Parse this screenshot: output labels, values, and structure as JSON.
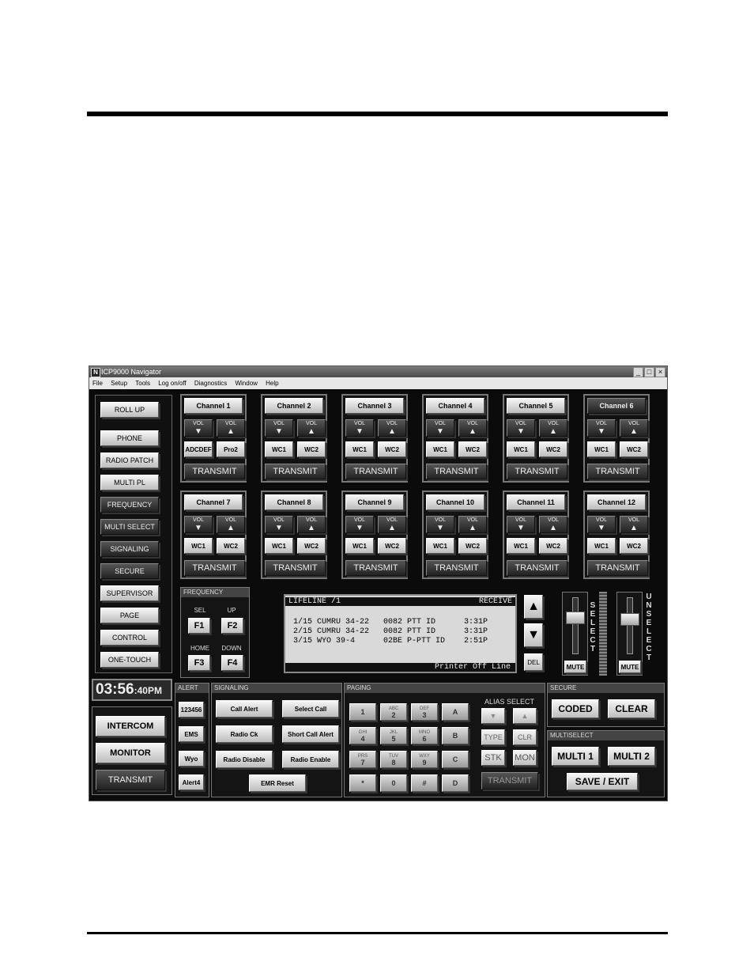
{
  "window": {
    "title": "ICP9000 Navigator",
    "logo": "N",
    "controls": [
      "_",
      "□",
      "×"
    ]
  },
  "menu": [
    "File",
    "Setup",
    "Tools",
    "Log on/off",
    "Diagnostics",
    "Window",
    "Help"
  ],
  "left_panel": {
    "roll_up": "ROLL UP",
    "items": [
      "PHONE",
      "RADIO PATCH",
      "MULTI PL",
      "FREQUENCY",
      "MULTI SELECT",
      "SIGNALING",
      "SECURE",
      "SUPERVISOR",
      "PAGE",
      "CONTROL",
      "ONE-TOUCH"
    ]
  },
  "channels": [
    {
      "name": "Channel 1",
      "wc1": "ADCDEF",
      "wc2": "Pro2"
    },
    {
      "name": "Channel 2",
      "wc1": "WC1",
      "wc2": "WC2"
    },
    {
      "name": "Channel 3",
      "wc1": "WC1",
      "wc2": "WC2"
    },
    {
      "name": "Channel 4",
      "wc1": "WC1",
      "wc2": "WC2"
    },
    {
      "name": "Channel 5",
      "wc1": "WC1",
      "wc2": "WC2"
    },
    {
      "name": "Channel 6",
      "wc1": "WC1",
      "wc2": "WC2"
    },
    {
      "name": "Channel 7",
      "wc1": "WC1",
      "wc2": "WC2"
    },
    {
      "name": "Channel 8",
      "wc1": "WC1",
      "wc2": "WC2"
    },
    {
      "name": "Channel 9",
      "wc1": "WC1",
      "wc2": "WC2"
    },
    {
      "name": "Channel 10",
      "wc1": "WC1",
      "wc2": "WC2"
    },
    {
      "name": "Channel 11",
      "wc1": "WC1",
      "wc2": "WC2"
    },
    {
      "name": "Channel 12",
      "wc1": "WC1",
      "wc2": "WC2"
    }
  ],
  "channel_common": {
    "vol": "VOL",
    "vol_down_glyph": "▼",
    "vol_up_glyph": "▲",
    "transmit": "TRANSMIT"
  },
  "frequency": {
    "header": "FREQUENCY",
    "sel": "SEL",
    "up": "UP",
    "home": "HOME",
    "down": "DOWN",
    "f1": "F1",
    "f2": "F2",
    "f3": "F3",
    "f4": "F4"
  },
  "display": {
    "title": "LIFELINE /1",
    "mode": "RECEIVE",
    "rows": [
      "1/15 CUMRU 34-22   0082 PTT ID      3:31P",
      "2/15 CUMRU 34-22   0082 PTT ID      3:31P",
      "3/15 WYO 39-4      02BE P-PTT ID    2:51P"
    ],
    "status": "Printer Off Line",
    "up_glyph": "▲",
    "down_glyph": "▼",
    "del": "DEL"
  },
  "select_panel": {
    "select": "SELECT",
    "unselect": "UNSELECT",
    "mute": "MUTE"
  },
  "clock": {
    "time": "03:56",
    "ampm": ":40PM"
  },
  "bottom_left": {
    "intercom": "INTERCOM",
    "monitor": "MONITOR",
    "transmit": "TRANSMIT"
  },
  "alert": {
    "header": "ALERT",
    "items": [
      "123456",
      "EMS",
      "Wyo",
      "Alert4"
    ]
  },
  "signaling": {
    "header": "SIGNALING",
    "buttons": [
      "Call Alert",
      "Select Call",
      "Radio Ck",
      "Short Call Alert",
      "Radio Disable",
      "Radio Enable",
      "EMR Reset"
    ]
  },
  "paging": {
    "header": "PAGING",
    "keys": [
      {
        "sub": "",
        "main": "1"
      },
      {
        "sub": "ABC",
        "main": "2"
      },
      {
        "sub": "DEF",
        "main": "3"
      },
      {
        "sub": "",
        "main": "A"
      },
      {
        "sub": "GHI",
        "main": "4"
      },
      {
        "sub": "JKL",
        "main": "5"
      },
      {
        "sub": "MNO",
        "main": "6"
      },
      {
        "sub": "",
        "main": "B"
      },
      {
        "sub": "PRS",
        "main": "7"
      },
      {
        "sub": "TUV",
        "main": "8"
      },
      {
        "sub": "WXY",
        "main": "9"
      },
      {
        "sub": "",
        "main": "C"
      },
      {
        "sub": "",
        "main": "*"
      },
      {
        "sub": "",
        "main": "0"
      },
      {
        "sub": "",
        "main": "#"
      },
      {
        "sub": "",
        "main": "D"
      }
    ],
    "alias_select": "ALIAS SELECT",
    "alias_down": "▼",
    "alias_up": "▲",
    "type": "TYPE",
    "clr": "CLR",
    "stk": "STK",
    "mon": "MON",
    "transmit": "TRANSMIT"
  },
  "secure": {
    "header": "SECURE",
    "coded": "CODED",
    "clear": "CLEAR"
  },
  "multiselect": {
    "header": "MULTISELECT",
    "multi1": "MULTI 1",
    "multi2": "MULTI 2",
    "save_exit": "SAVE / EXIT"
  }
}
